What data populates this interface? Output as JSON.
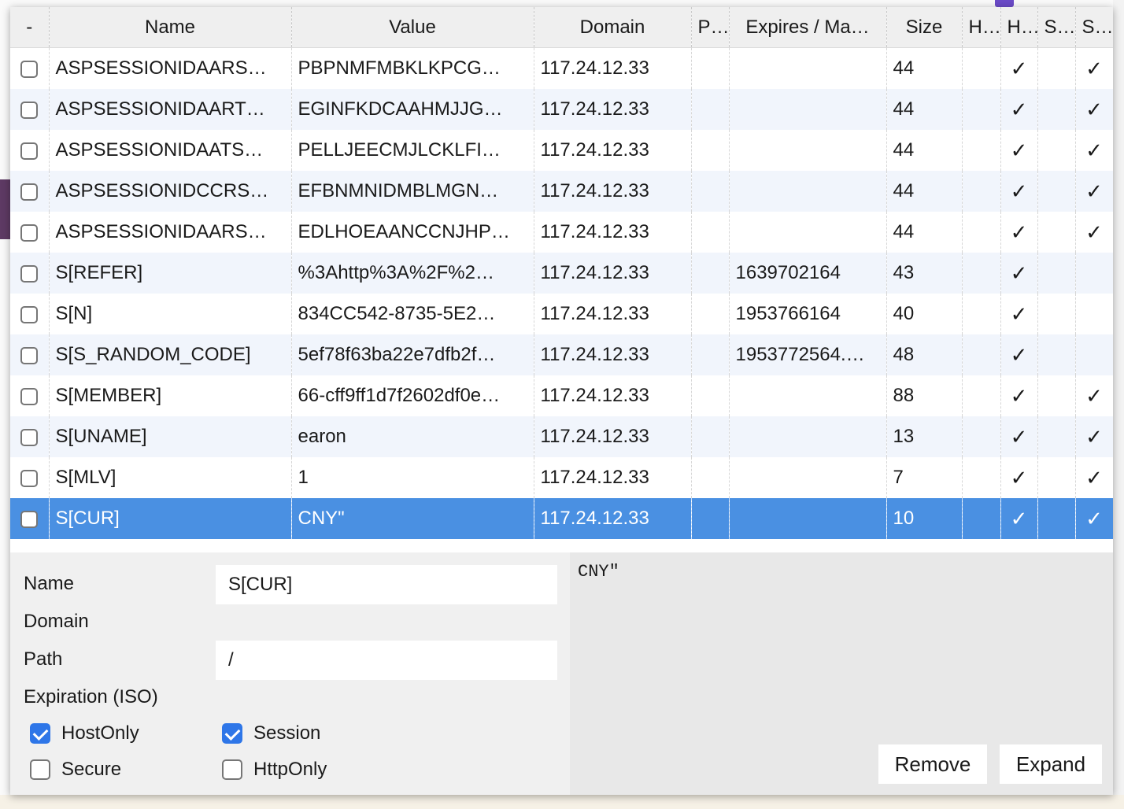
{
  "columns": [
    "-",
    "Name",
    "Value",
    "Domain",
    "P…",
    "Expires / Ma…",
    "Size",
    "H…",
    "H…",
    "S…",
    "S…"
  ],
  "rows": [
    {
      "name": "ASPSESSIONIDAARS…",
      "value": "PBPNMFMBKLKPCG…",
      "domain": "117.24.12.33",
      "p": "",
      "expires": "",
      "size": "44",
      "h1": "",
      "h2": "✓",
      "s1": "",
      "s2": "✓"
    },
    {
      "name": "ASPSESSIONIDAART…",
      "value": "EGINFKDCAAHMJJG…",
      "domain": "117.24.12.33",
      "p": "",
      "expires": "",
      "size": "44",
      "h1": "",
      "h2": "✓",
      "s1": "",
      "s2": "✓"
    },
    {
      "name": "ASPSESSIONIDAATS…",
      "value": "PELLJEECMJLCKLFI…",
      "domain": "117.24.12.33",
      "p": "",
      "expires": "",
      "size": "44",
      "h1": "",
      "h2": "✓",
      "s1": "",
      "s2": "✓"
    },
    {
      "name": "ASPSESSIONIDCCRS…",
      "value": "EFBNMNIDMBLMGN…",
      "domain": "117.24.12.33",
      "p": "",
      "expires": "",
      "size": "44",
      "h1": "",
      "h2": "✓",
      "s1": "",
      "s2": "✓"
    },
    {
      "name": "ASPSESSIONIDAARS…",
      "value": "EDLHOEAANCCNJHP…",
      "domain": "117.24.12.33",
      "p": "",
      "expires": "",
      "size": "44",
      "h1": "",
      "h2": "✓",
      "s1": "",
      "s2": "✓"
    },
    {
      "name": "S[REFER]",
      "value": "%3Ahttp%3A%2F%2…",
      "domain": "117.24.12.33",
      "p": "",
      "expires": "1639702164",
      "size": "43",
      "h1": "",
      "h2": "✓",
      "s1": "",
      "s2": ""
    },
    {
      "name": "S[N]",
      "value": "834CC542-8735-5E2…",
      "domain": "117.24.12.33",
      "p": "",
      "expires": "1953766164",
      "size": "40",
      "h1": "",
      "h2": "✓",
      "s1": "",
      "s2": ""
    },
    {
      "name": "S[S_RANDOM_CODE]",
      "value": "5ef78f63ba22e7dfb2f…",
      "domain": "117.24.12.33",
      "p": "",
      "expires": "1953772564.…",
      "size": "48",
      "h1": "",
      "h2": "✓",
      "s1": "",
      "s2": ""
    },
    {
      "name": "S[MEMBER]",
      "value": "66-cff9ff1d7f2602df0e…",
      "domain": "117.24.12.33",
      "p": "",
      "expires": "",
      "size": "88",
      "h1": "",
      "h2": "✓",
      "s1": "",
      "s2": "✓"
    },
    {
      "name": "S[UNAME]",
      "value": "earon",
      "domain": "117.24.12.33",
      "p": "",
      "expires": "",
      "size": "13",
      "h1": "",
      "h2": "✓",
      "s1": "",
      "s2": "✓"
    },
    {
      "name": "S[MLV]",
      "value": "1",
      "domain": "117.24.12.33",
      "p": "",
      "expires": "",
      "size": "7",
      "h1": "",
      "h2": "✓",
      "s1": "",
      "s2": "✓"
    },
    {
      "name": "S[CUR]",
      "value": "CNY\"",
      "domain": "117.24.12.33",
      "p": "",
      "expires": "",
      "size": "10",
      "h1": "",
      "h2": "✓",
      "s1": "",
      "s2": "✓"
    }
  ],
  "selected_row": 11,
  "detail": {
    "labels": {
      "name": "Name",
      "domain": "Domain",
      "path": "Path",
      "expiration": "Expiration (ISO)"
    },
    "name_value": "S[CUR]",
    "path_value": "/",
    "checkboxes": {
      "hostonly": {
        "label": "HostOnly",
        "checked": true
      },
      "session": {
        "label": "Session",
        "checked": true
      },
      "secure": {
        "label": "Secure",
        "checked": false
      },
      "httponly": {
        "label": "HttpOnly",
        "checked": false
      }
    },
    "preview_text": "CNY\"",
    "remove_label": "Remove",
    "expand_label": "Expand"
  },
  "colors": {
    "selected_row": "#4a90e2",
    "checkbox_on": "#2e76e8",
    "bg_band": "#5e3a64"
  }
}
